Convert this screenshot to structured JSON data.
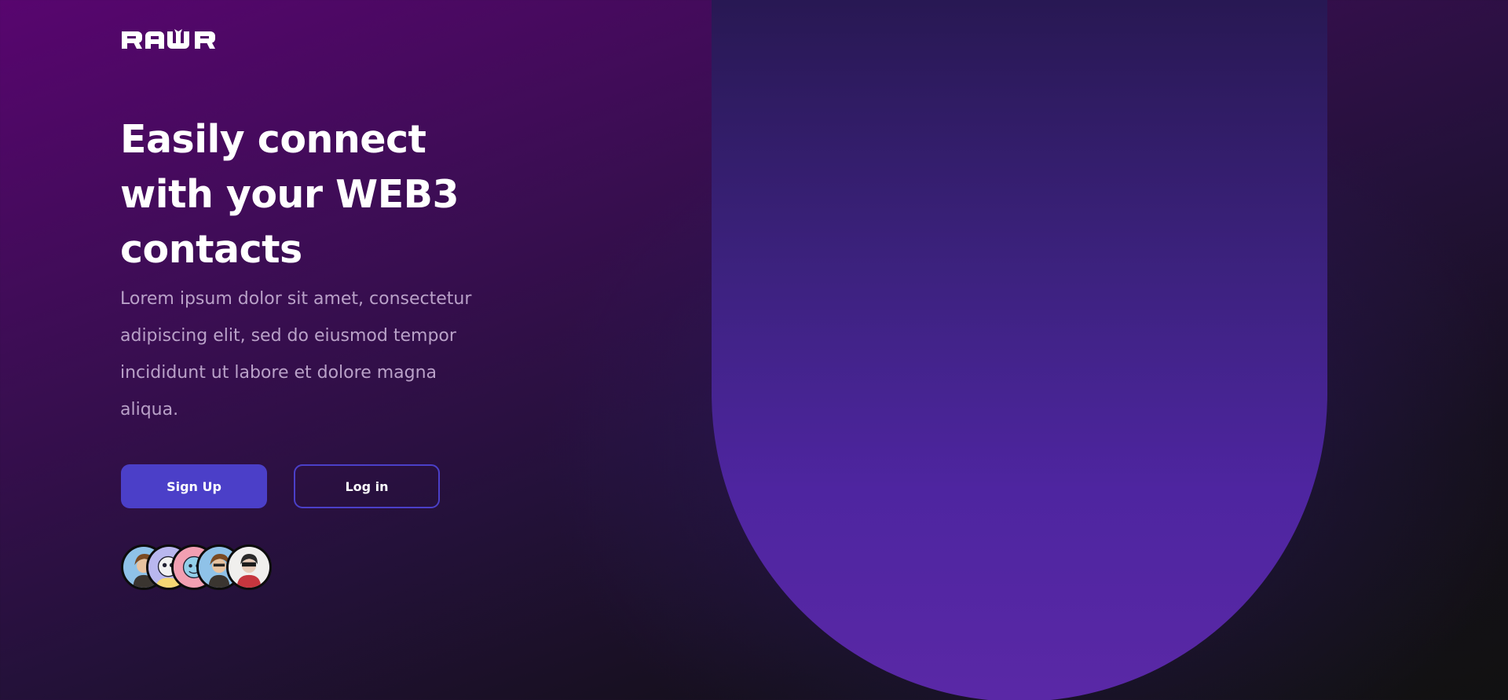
{
  "brand": {
    "logo_text": "RAWR",
    "logo_icon": "rawr-logo"
  },
  "hero": {
    "headline": "Easily connect with your WEB3 contacts",
    "subtext": "Lorem ipsum dolor sit amet, consectetur adipiscing elit, sed do eiusmod tempor incididunt ut labore et dolore magna aliqua."
  },
  "actions": {
    "signup_label": "Sign Up",
    "login_label": "Log in"
  },
  "avatars": [
    {
      "icon": "user-avatar-1"
    },
    {
      "icon": "user-avatar-2"
    },
    {
      "icon": "user-avatar-3"
    },
    {
      "icon": "user-avatar-4"
    },
    {
      "icon": "user-avatar-5"
    }
  ],
  "colors": {
    "accent": "#4b3fc8",
    "background_top": "#58056f",
    "background_bottom": "#111111",
    "shape": "#5a28a6",
    "subtext": "#b9a1c8"
  }
}
